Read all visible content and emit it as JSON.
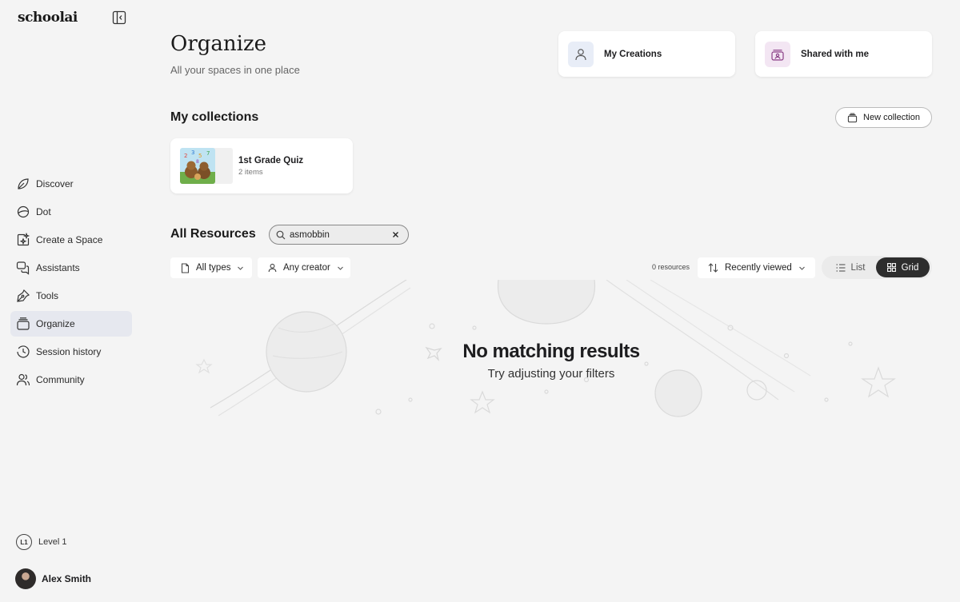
{
  "app": {
    "logo": "schoolai"
  },
  "sidebar": {
    "items": [
      {
        "label": "Discover",
        "icon": "leaf-icon"
      },
      {
        "label": "Dot",
        "icon": "dot-planet-icon"
      },
      {
        "label": "Create a Space",
        "icon": "create-space-icon"
      },
      {
        "label": "Assistants",
        "icon": "chat-bubbles-icon"
      },
      {
        "label": "Tools",
        "icon": "pen-tool-icon"
      },
      {
        "label": "Organize",
        "icon": "stack-icon",
        "active": true
      },
      {
        "label": "Session history",
        "icon": "clock-icon"
      },
      {
        "label": "Community",
        "icon": "users-icon"
      }
    ],
    "level_badge": "L1",
    "level_label": "Level 1",
    "user_name": "Alex Smith"
  },
  "header": {
    "title": "Organize",
    "subtitle": "All your spaces in one place",
    "cards": {
      "my_creations": "My Creations",
      "shared_with_me": "Shared with me"
    }
  },
  "collections": {
    "title": "My collections",
    "new_button": "New collection",
    "items": [
      {
        "name": "1st Grade Quiz",
        "count": "2 items"
      }
    ]
  },
  "resources": {
    "title": "All Resources",
    "search_value": "asmobbin",
    "filters": {
      "type": "All types",
      "creator": "Any creator"
    },
    "count": "0 resources",
    "sort": "Recently viewed",
    "view": {
      "list": "List",
      "grid": "Grid",
      "selected": "Grid"
    },
    "empty_title": "No matching results",
    "empty_subtitle": "Try adjusting your filters"
  },
  "colors": {
    "background": "#f4f4f4",
    "active_nav": "#e6e8ef",
    "creations_tile": "#e8edf7",
    "shared_tile": "#f3e6f3",
    "toggle_active": "#2d2d2d"
  }
}
